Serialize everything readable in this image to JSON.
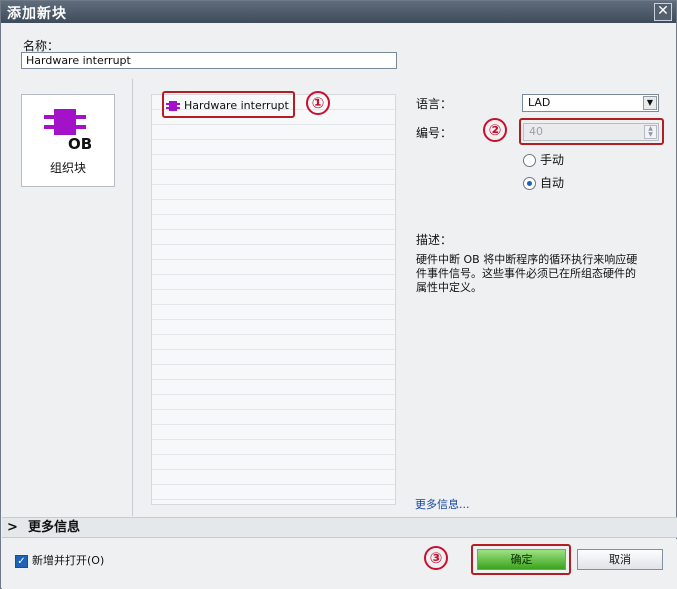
{
  "window": {
    "title": "添加新块",
    "close_glyph": "✕"
  },
  "name": {
    "label": "名称：",
    "value": "Hardware interrupt"
  },
  "block_types": [
    {
      "label": "组织块",
      "icon": "ob-block-icon",
      "icon_text": "OB"
    }
  ],
  "list": {
    "items": [
      {
        "label": "Hardware interrupt",
        "icon": "ob-block-small-icon"
      }
    ]
  },
  "language": {
    "label": "语言：",
    "value": "LAD"
  },
  "number": {
    "label": "编号：",
    "value": "40"
  },
  "numbering": {
    "options": [
      {
        "label": "手动",
        "selected": false
      },
      {
        "label": "自动",
        "selected": true
      }
    ]
  },
  "description": {
    "label": "描述：",
    "lines": [
      "硬件中断 OB 将中断程序的循环执行来响应硬",
      "件事件信号。这些事件必须已在所组态硬件的",
      "属性中定义。"
    ]
  },
  "more_info_link": "更多信息...",
  "more_info_bar": {
    "label": "更多信息",
    "chevron": ">"
  },
  "open_checkbox": {
    "label": "新增并打开(O)",
    "checked": true
  },
  "buttons": {
    "ok": "确定",
    "cancel": "取消"
  },
  "callouts": [
    "①",
    "②",
    "③"
  ],
  "colors": {
    "callout": "#c8102e",
    "ok_button": "#3ba31d",
    "title_bar": "#4a5766",
    "link": "#1745a8"
  }
}
